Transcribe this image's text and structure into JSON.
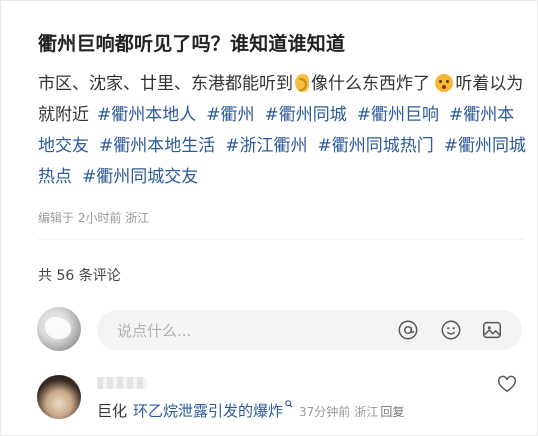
{
  "post": {
    "title": "衢州巨响都听见了吗？谁知道谁知道",
    "text_part1": "市区、沈家、廿里、东港都能听到",
    "text_part2": "像什么东西炸了",
    "text_part3": "听着以为就附近",
    "tags": [
      "#衢州本地人",
      "#衢州",
      "#衢州同城",
      "#衢州巨响",
      "#衢州本地交友",
      "#衢州本地生活",
      "#浙江衢州",
      "#衢州同城热门",
      "#衢州同城热点",
      "#衢州同城交友"
    ],
    "emoji_1": "ear-emoji",
    "emoji_2": "hushed-face-emoji",
    "meta": "编辑于 2小时前 浙江"
  },
  "comments_section": {
    "count_label": "共 56 条评论",
    "input_placeholder": "说点什么...",
    "input_icons": [
      "at-icon",
      "emoji-icon",
      "image-icon"
    ]
  },
  "comments": [
    {
      "text_prefix": "巨化",
      "link_text": "环乙烷泄露引发的爆炸",
      "time": "37分钟前",
      "location": "浙江",
      "reply_label": "回复"
    }
  ],
  "colors": {
    "tag": "#2b5b9a",
    "meta": "#999999",
    "input_bg": "#f4f4f4"
  }
}
